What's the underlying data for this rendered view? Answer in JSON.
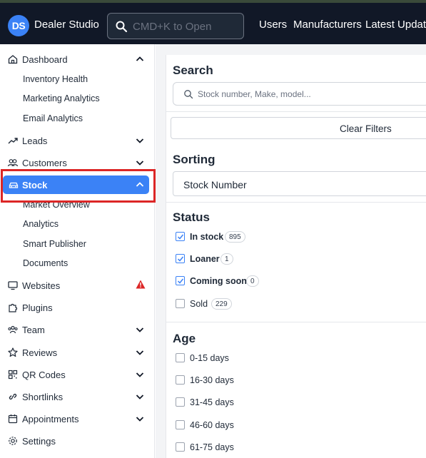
{
  "header": {
    "logo_initials": "DS",
    "app_name": "Dealer Studio",
    "search_placeholder": "CMD+K to Open",
    "nav": [
      "Users",
      "Manufacturers",
      "Latest Update"
    ]
  },
  "sidebar": {
    "items": [
      {
        "label": "Dashboard",
        "icon": "home-icon",
        "chevron": "up"
      },
      {
        "label": "Inventory Health",
        "sub": true
      },
      {
        "label": "Marketing Analytics",
        "sub": true
      },
      {
        "label": "Email Analytics",
        "sub": true
      },
      {
        "label": "Leads",
        "icon": "trend-icon",
        "chevron": "down"
      },
      {
        "label": "Customers",
        "icon": "users-icon",
        "chevron": "down"
      },
      {
        "label": "Stock",
        "icon": "car-icon",
        "chevron": "up",
        "active": true
      },
      {
        "label": "Market Overview",
        "sub": true
      },
      {
        "label": "Analytics",
        "sub": true
      },
      {
        "label": "Smart Publisher",
        "sub": true
      },
      {
        "label": "Documents",
        "sub": true
      },
      {
        "label": "Websites",
        "icon": "monitor-icon",
        "warning": true
      },
      {
        "label": "Plugins",
        "icon": "puzzle-icon"
      },
      {
        "label": "Team",
        "icon": "team-icon",
        "chevron": "down"
      },
      {
        "label": "Reviews",
        "icon": "star-icon",
        "chevron": "down"
      },
      {
        "label": "QR Codes",
        "icon": "qr-icon",
        "chevron": "down"
      },
      {
        "label": "Shortlinks",
        "icon": "link-icon",
        "chevron": "down"
      },
      {
        "label": "Appointments",
        "icon": "calendar-icon",
        "chevron": "down"
      },
      {
        "label": "Settings",
        "icon": "gear-icon"
      }
    ]
  },
  "filters": {
    "search_title": "Search",
    "search_placeholder": "Stock number, Make, model...",
    "clear_label": "Clear Filters",
    "sorting_title": "Sorting",
    "sorting_value": "Stock Number",
    "status_title": "Status",
    "status": [
      {
        "label": "In stock",
        "count": "895",
        "checked": true
      },
      {
        "label": "Loaner",
        "count": "1",
        "checked": true
      },
      {
        "label": "Coming soon",
        "count": "0",
        "checked": true
      },
      {
        "label": "Sold",
        "count": "229",
        "checked": false
      }
    ],
    "age_title": "Age",
    "age": [
      {
        "label": "0-15 days",
        "checked": false
      },
      {
        "label": "16-30 days",
        "checked": false
      },
      {
        "label": "31-45 days",
        "checked": false
      },
      {
        "label": "46-60 days",
        "checked": false
      },
      {
        "label": "61-75 days",
        "checked": false
      }
    ]
  },
  "colors": {
    "accent": "#3b82f6",
    "topbar": "#111827",
    "highlight": "#dc2626"
  }
}
